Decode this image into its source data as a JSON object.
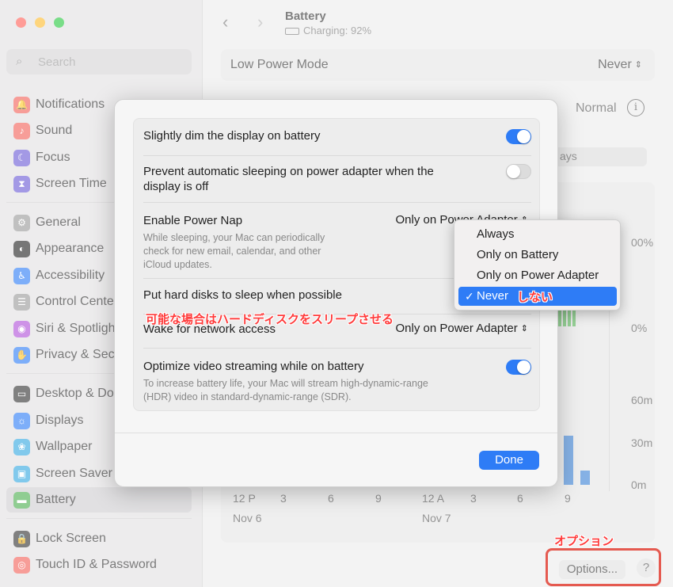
{
  "window": {
    "traffic_lights": [
      "close",
      "minimize",
      "zoom"
    ]
  },
  "sidebar": {
    "search_placeholder": "Search",
    "items": [
      {
        "label": "Notifications",
        "icon": "bell-icon",
        "color": "#f2625a"
      },
      {
        "label": "Sound",
        "icon": "speaker-icon",
        "color": "#f2625a"
      },
      {
        "label": "Focus",
        "icon": "moon-icon",
        "color": "#6b5bd6"
      },
      {
        "label": "Screen Time",
        "icon": "hourglass-icon",
        "color": "#6b5bd6"
      },
      {
        "label": "General",
        "icon": "gear-icon",
        "color": "#9a9a9a"
      },
      {
        "label": "Appearance",
        "icon": "appearance-icon",
        "color": "#222222"
      },
      {
        "label": "Accessibility",
        "icon": "accessibility-icon",
        "color": "#2e7cf6"
      },
      {
        "label": "Control Cente",
        "icon": "control-center-icon",
        "color": "#9a9a9a"
      },
      {
        "label": "Siri & Spotligh",
        "icon": "siri-icon",
        "color": "#b04fd9"
      },
      {
        "label": "Privacy & Sec",
        "icon": "hand-icon",
        "color": "#2e7cf6"
      },
      {
        "label": "Desktop & Do",
        "icon": "desktop-icon",
        "color": "#333333"
      },
      {
        "label": "Displays",
        "icon": "display-icon",
        "color": "#2e7cf6"
      },
      {
        "label": "Wallpaper",
        "icon": "wallpaper-icon",
        "color": "#35a8e0"
      },
      {
        "label": "Screen Saver",
        "icon": "screen-saver-icon",
        "color": "#35a8e0"
      },
      {
        "label": "Battery",
        "icon": "battery-icon",
        "color": "#4caf50"
      },
      {
        "label": "Lock Screen",
        "icon": "lock-icon",
        "color": "#333333"
      },
      {
        "label": "Touch ID & Password",
        "icon": "fingerprint-icon",
        "color": "#f2625a"
      }
    ]
  },
  "header": {
    "back_icon": "chevron-left-icon",
    "forward_icon": "chevron-right-icon",
    "title": "Battery",
    "subtitle": "Charging: 92%"
  },
  "background": {
    "low_power_label": "Low Power Mode",
    "low_power_value": "Never",
    "normal_label": "Normal",
    "tab_partial": "ays",
    "y_labels_pct": [
      "00%",
      "0%"
    ],
    "y_labels_time": [
      "60m",
      "30m",
      "0m"
    ],
    "x_labels": [
      "12 P",
      "3",
      "6",
      "9",
      "12 A",
      "3",
      "6",
      "9"
    ],
    "x_label_partial_9": "9",
    "date_labels": [
      "Nov 6",
      "Nov 7"
    ]
  },
  "footer": {
    "options_label": "Options...",
    "help_label": "?"
  },
  "modal": {
    "rows": [
      {
        "title": "Slightly dim the display on battery",
        "toggle": true
      },
      {
        "title": "Prevent automatic sleeping on power adapter when the",
        "title2": "display is off",
        "toggle": false
      },
      {
        "title": "Enable Power Nap",
        "desc1": "While sleeping, your Mac can periodically",
        "desc2": "check for new email, calendar, and other",
        "desc3": "iCloud updates.",
        "select": "Only on Power Adapter"
      },
      {
        "title": "Put hard disks to sleep when possible"
      },
      {
        "title": "Wake for network access",
        "select": "Only on Power Adapter"
      },
      {
        "title": "Optimize video streaming while on battery",
        "desc1": "To increase battery life, your Mac will stream high-dynamic-range",
        "desc2": "(HDR) video in standard-dynamic-range (SDR).",
        "toggle": true
      }
    ],
    "done_label": "Done"
  },
  "dropdown": {
    "options": [
      "Always",
      "Only on Battery",
      "Only on Power Adapter",
      "Never"
    ],
    "selected": "Never"
  },
  "annotations": {
    "never_jp": "しない",
    "hard_disk_jp": "可能な場合はハードディスクをスリープさせる",
    "options_jp": "オプション"
  },
  "colors": {
    "accent": "#2e7cf6",
    "annotation": "#ff3b3b"
  }
}
